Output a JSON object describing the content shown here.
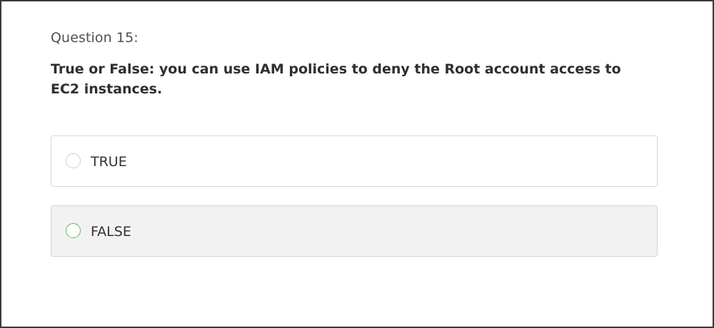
{
  "question": {
    "number_label": "Question 15:",
    "text": "True or False: you can use IAM policies to deny the Root account access to EC2 instances."
  },
  "options": [
    {
      "label": "TRUE",
      "state": "default"
    },
    {
      "label": "FALSE",
      "state": "hover"
    }
  ],
  "colors": {
    "frame_border": "#3a3a3a",
    "option_border": "#d6d6d6",
    "option_hover_background": "#f2f2f2",
    "radio_hover_border": "#5cb85c"
  }
}
